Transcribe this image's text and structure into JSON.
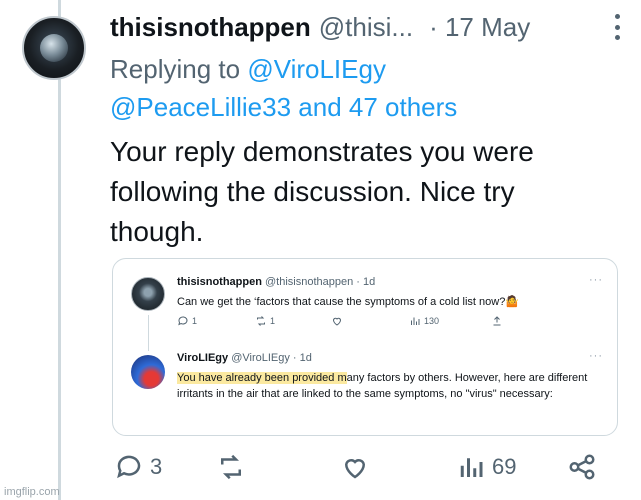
{
  "tweet": {
    "author_name": "thisisnothappen",
    "author_handle": "@thisi...",
    "date": "· 17 May",
    "reply_prefix": "Replying to",
    "reply_handle_1": "@ViroLIEgy",
    "reply_handle_2": "@PeaceLillie33 and 47 others",
    "text": "Your reply demonstrates you were following the discussion. Nice try though.",
    "stats": {
      "replies": "3",
      "views": "69"
    }
  },
  "quoted": {
    "first": {
      "name": "thisisnothappen",
      "handle_time": "@thisisnothappen · 1d",
      "text": "Can we get the ‘factors that cause the symptoms of a cold list now?🤷",
      "replies": "1",
      "reposts": "1",
      "views": "130",
      "more": "···"
    },
    "second": {
      "name": "ViroLIEgy",
      "handle_time": "@ViroLIEgy · 1d",
      "text_highlight": "You have already been provided m",
      "text_rest": "any factors by others. However, here are different irritants in the air that are linked to the same symptoms, no \"virus\" necessary:",
      "more": "···"
    }
  },
  "icons": [
    "reply-icon",
    "repost-icon",
    "like-icon",
    "views-icon",
    "share-icon",
    "more-icon"
  ],
  "colors": {
    "link": "#1d9bf0",
    "muted": "#536471",
    "highlight": "#fbe9a0"
  },
  "watermark": "imgflip.com"
}
